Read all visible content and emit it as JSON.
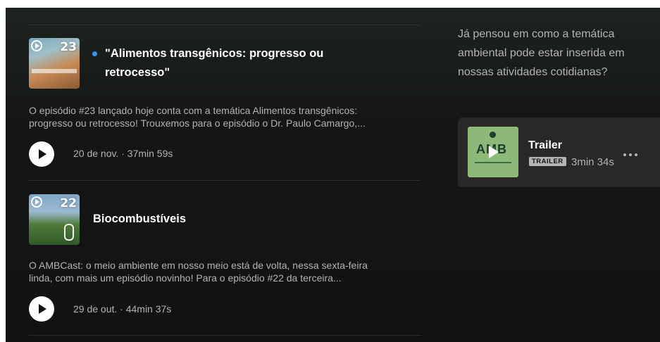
{
  "episodes": [
    {
      "number_badge": "23",
      "title_line1": "\"Alimentos transgênicos: progresso ou",
      "title_line2": "retrocesso\"",
      "is_new": true,
      "desc_line1": "O episódio #23 lançado hoje conta com a temática Alimentos transgênicos:",
      "desc_line2": "progresso ou retrocesso! Trouxemos para o episódio o Dr. Paulo Camargo,...",
      "meta": "20 de nov. · 37min 59s"
    },
    {
      "number_badge": "22",
      "title_line1": "Biocombustíveis",
      "is_new": false,
      "desc_line1": "O AMBCast: o meio ambiente em nosso meio está de volta, nessa sexta-feira",
      "desc_line2": "linda, com mais um episódio novinho! Para o episódio #22 da terceira...",
      "meta": "29 de out. · 44min 37s"
    }
  ],
  "about": {
    "line1": "Já pensou em como a temática",
    "line2": "ambiental pode estar inserida em",
    "line3": "nossas atividades cotidianas?"
  },
  "trailer": {
    "art_logo": "AMB",
    "title": "Trailer",
    "badge": "TRAILER",
    "duration": "3min 34s"
  },
  "colors": {
    "accent_dot": "#3d91f4",
    "background": "#121212",
    "card": "#282828",
    "muted_text": "#b3b3b3"
  },
  "icons": [
    "play-icon",
    "more-options-icon",
    "new-episode-dot-icon",
    "microphone-icon"
  ]
}
